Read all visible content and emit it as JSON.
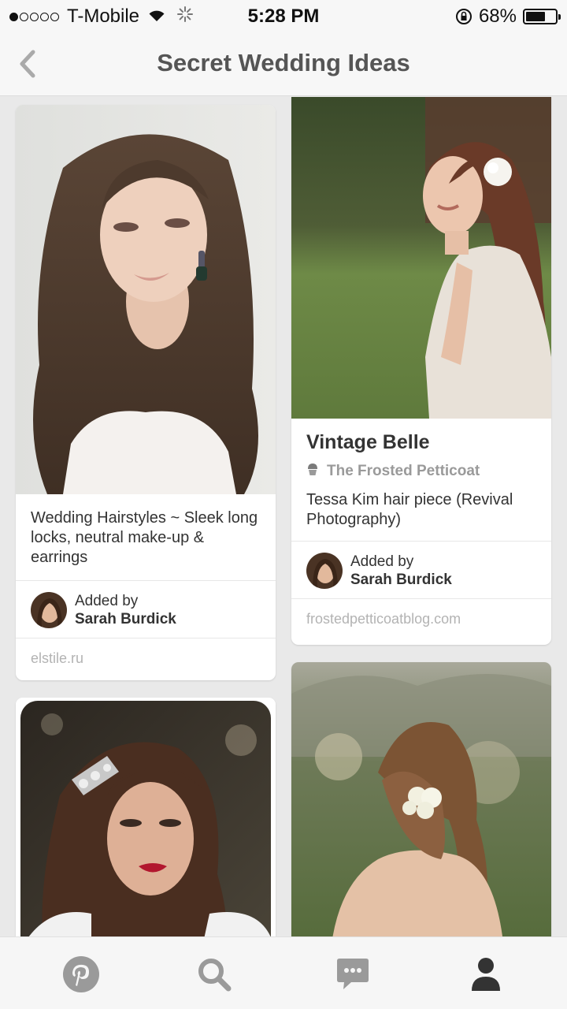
{
  "status_bar": {
    "carrier": "T-Mobile",
    "time": "5:28 PM",
    "battery_percent": "68%",
    "battery_level": 0.68,
    "signal_bars": 1
  },
  "nav": {
    "title": "Secret Wedding Ideas",
    "back_icon": "chevron-left-icon"
  },
  "pins": [
    {
      "description": "Wedding Hairstyles ~ Sleek long locks, neutral make-up & earrings",
      "added_by": "Added by",
      "pinner": "Sarah Burdick",
      "source": "elstile.ru"
    },
    {
      "title": "Vintage Belle",
      "board": "The Frosted Petticoat",
      "description": "Tessa Kim hair piece (Revival Photography)",
      "added_by": "Added by",
      "pinner": "Sarah Burdick",
      "source": "frostedpetticoatblog.com"
    }
  ],
  "tabs": [
    {
      "icon": "pinterest-logo-icon",
      "name": "home"
    },
    {
      "icon": "search-icon",
      "name": "search"
    },
    {
      "icon": "messages-icon",
      "name": "messages"
    },
    {
      "icon": "profile-icon",
      "name": "profile",
      "active": true
    }
  ],
  "colors": {
    "tab_inactive": "#9a9a9a",
    "tab_active": "#333333",
    "background": "#e9e9e9"
  }
}
